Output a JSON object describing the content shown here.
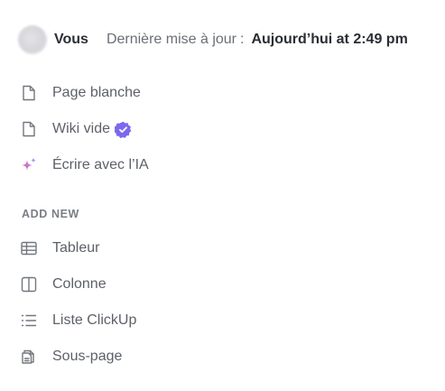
{
  "header": {
    "author": "Vous",
    "updated_label": "Dernière mise à jour",
    "updated_separator": ":",
    "updated_value": "Aujourd’hui at 2:49 pm"
  },
  "create_items": [
    {
      "label": "Page blanche",
      "icon": "page-icon"
    },
    {
      "label": "Wiki vide",
      "icon": "page-icon",
      "badge": "verified-badge-icon"
    },
    {
      "label": "Écrire avec l’IA",
      "icon": "ai-sparkle-icon"
    }
  ],
  "add_new": {
    "title": "ADD NEW",
    "items": [
      {
        "label": "Tableur",
        "icon": "table-icon"
      },
      {
        "label": "Colonne",
        "icon": "column-icon"
      },
      {
        "label": "Liste ClickUp",
        "icon": "list-icon"
      },
      {
        "label": "Sous-page",
        "icon": "subpage-icon"
      }
    ]
  },
  "colors": {
    "text": "#2a2e34",
    "muted": "#6b6f76",
    "icon": "#73777e",
    "verified": "#7b68ee",
    "sparkle_pink": "#f06292",
    "sparkle_purple": "#a78bfa"
  }
}
